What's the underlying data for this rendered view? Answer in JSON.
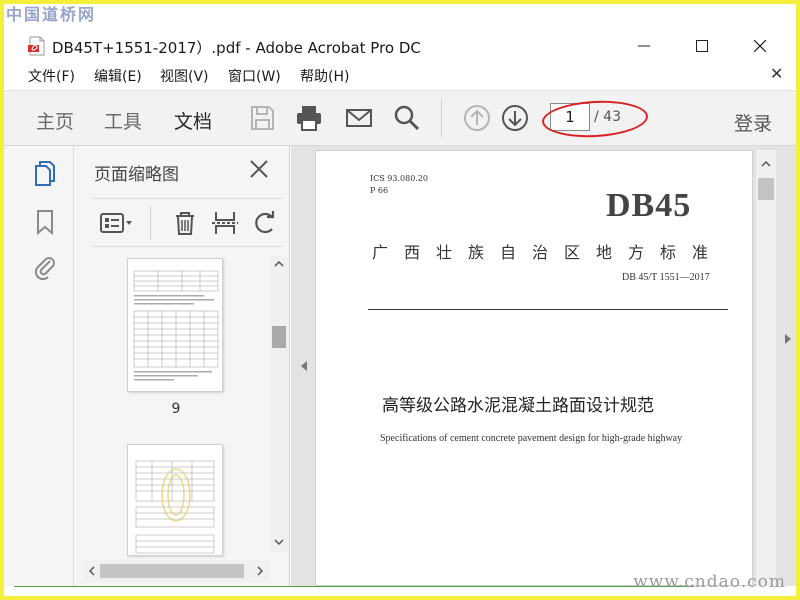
{
  "watermarks": {
    "top": "中国道桥网",
    "bottom": "www.cndao.com"
  },
  "titlebar": {
    "title": "DB45T+1551-2017）.pdf - Adobe Acrobat Pro DC"
  },
  "menu": [
    "文件(F)",
    "编辑(E)",
    "视图(V)",
    "窗口(W)",
    "帮助(H)"
  ],
  "toolbar": {
    "tabs": [
      "主页",
      "工具",
      "文档"
    ],
    "active_tab": "文档",
    "page_current": "1",
    "page_total": "/ 43",
    "login": "登录"
  },
  "thumbnails": {
    "title": "页面缩略图",
    "page_label": "9"
  },
  "document": {
    "ics": "ICS 93.080.20",
    "p": "P 66",
    "code": "DB45",
    "standard": "广西壮族自治区地方标准",
    "number": "DB 45/T 1551—2017",
    "title_cn": "高等级公路水泥混凝土路面设计规范",
    "title_en": "Specifications of cement concrete pavement design for high-grade highway"
  },
  "colors": {
    "frame": "#f4ef3a",
    "highlight": "#d82222",
    "icon_blue": "#2f6fb8"
  }
}
